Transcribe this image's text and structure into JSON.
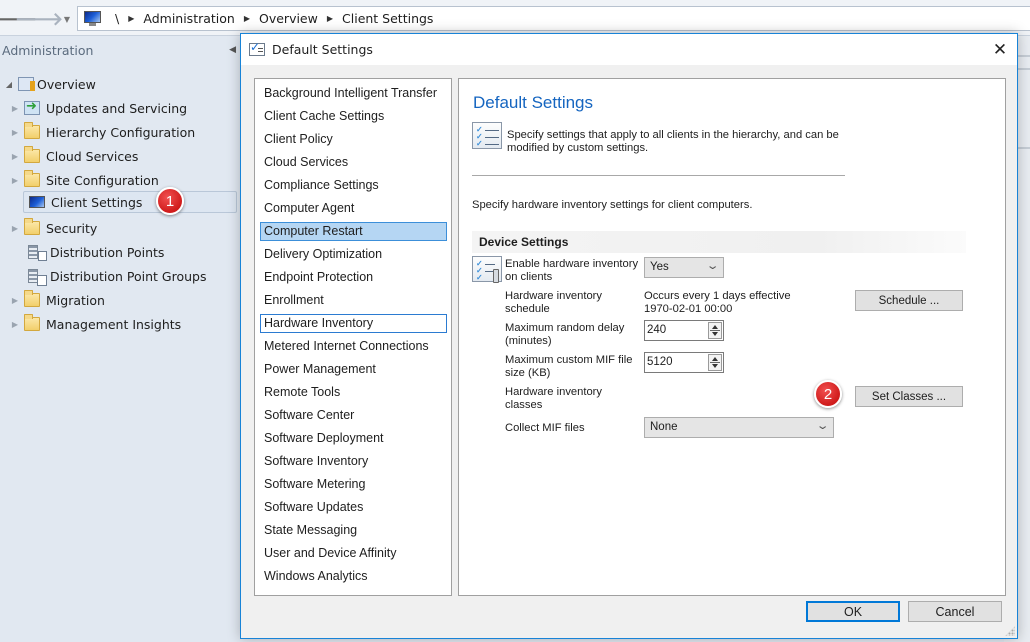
{
  "console": {
    "breadcrumb": [
      "\\",
      "Administration",
      "Overview",
      "Client Settings"
    ],
    "nav_pane": {
      "header": "Administration",
      "items": [
        {
          "label": "Overview",
          "icon": "overview-icon",
          "expander": "expanded"
        },
        {
          "label": "Updates and Servicing",
          "icon": "updates-icon",
          "expander": "collapsed"
        },
        {
          "label": "Hierarchy Configuration",
          "icon": "folder-icon",
          "expander": "collapsed"
        },
        {
          "label": "Cloud Services",
          "icon": "folder-icon",
          "expander": "collapsed"
        },
        {
          "label": "Site Configuration",
          "icon": "folder-icon",
          "expander": "collapsed"
        },
        {
          "label": "Client Settings",
          "icon": "client-settings-icon",
          "expander": "none",
          "selected": true
        },
        {
          "label": "Security",
          "icon": "folder-icon",
          "expander": "collapsed"
        },
        {
          "label": "Distribution Points",
          "icon": "distribution-points-icon",
          "expander": "none"
        },
        {
          "label": "Distribution Point Groups",
          "icon": "distribution-point-groups-icon",
          "expander": "none"
        },
        {
          "label": "Migration",
          "icon": "folder-icon",
          "expander": "collapsed"
        },
        {
          "label": "Management Insights",
          "icon": "folder-icon",
          "expander": "collapsed"
        }
      ]
    },
    "annotations": [
      {
        "number": "1",
        "color": "#d42020"
      },
      {
        "number": "2",
        "color": "#d42020"
      }
    ]
  },
  "dialog": {
    "title": "Default Settings",
    "close_glyph": "✕",
    "categories": [
      "Background Intelligent Transfer",
      "Client Cache Settings",
      "Client Policy",
      "Cloud Services",
      "Compliance Settings",
      "Computer Agent",
      "Computer Restart",
      "Delivery Optimization",
      "Endpoint Protection",
      "Enrollment",
      "Hardware Inventory",
      "Metered Internet Connections",
      "Power Management",
      "Remote Tools",
      "Software Center",
      "Software Deployment",
      "Software Inventory",
      "Software Metering",
      "Software Updates",
      "State Messaging",
      "User and Device Affinity",
      "Windows Analytics"
    ],
    "selected_category": "Computer Restart",
    "focused_category": "Hardware Inventory",
    "content": {
      "title": "Default Settings",
      "info_text": "Specify settings that apply to all clients in the hierarchy, and can be modified by custom settings.",
      "description": "Specify hardware inventory settings for client computers.",
      "section_title": "Device Settings",
      "settings": {
        "enable_label": "Enable hardware inventory on clients",
        "enable_value": "Yes",
        "schedule_label": "Hardware inventory schedule",
        "schedule_value_line1": "Occurs every 1 days effective",
        "schedule_value_line2": "1970-02-01 00:00",
        "schedule_button": "Schedule ...",
        "delay_label": "Maximum random delay (minutes)",
        "delay_value": "240",
        "mif_size_label": "Maximum custom MIF file size (KB)",
        "mif_size_value": "5120",
        "classes_label": "Hardware inventory classes",
        "classes_button": "Set Classes ...",
        "collect_mif_label": "Collect MIF files",
        "collect_mif_value": "None"
      }
    },
    "buttons": {
      "ok": "OK",
      "cancel": "Cancel"
    },
    "accent_color": "#0078d7"
  }
}
